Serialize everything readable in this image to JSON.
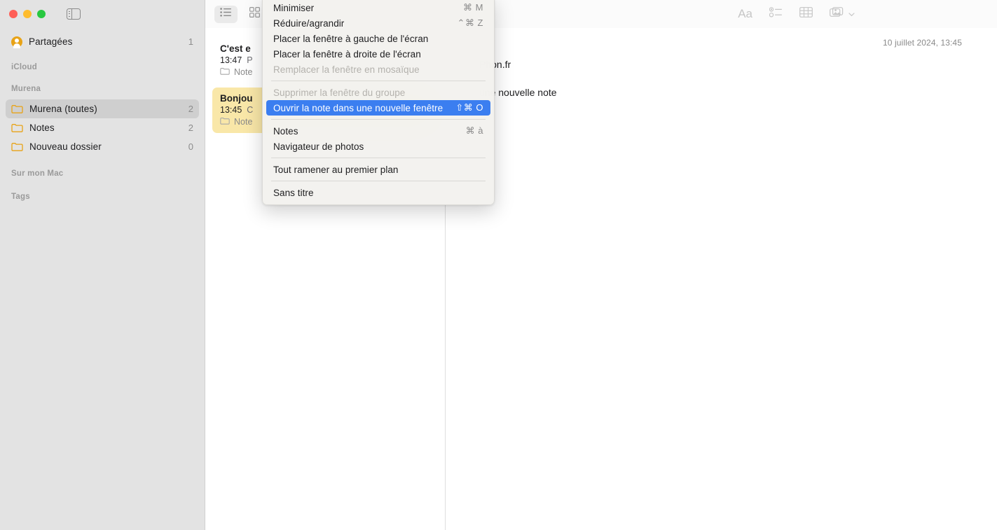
{
  "window": {
    "traffic_lights": [
      "close",
      "minimize",
      "maximize"
    ],
    "sidebar_toggle_icon": "sidebar-toggle-icon"
  },
  "sidebar": {
    "shared": {
      "label": "Partagées",
      "count": "1",
      "icon": "shared-person-icon"
    },
    "sections": [
      {
        "header": "iCloud",
        "items": []
      },
      {
        "header": "Murena",
        "items": [
          {
            "label": "Murena (toutes)",
            "count": "2",
            "icon": "folder-icon",
            "selected": true
          },
          {
            "label": "Notes",
            "count": "2",
            "icon": "folder-icon",
            "selected": false
          },
          {
            "label": "Nouveau dossier",
            "count": "0",
            "icon": "folder-icon",
            "selected": false
          }
        ]
      },
      {
        "header": "Sur mon Mac",
        "items": []
      },
      {
        "header": "Tags",
        "items": []
      }
    ]
  },
  "list_toolbar": {
    "buttons": [
      {
        "name": "list-view-button",
        "icon": "list-view-icon",
        "active": true
      },
      {
        "name": "gallery-view-button",
        "icon": "gallery-view-icon",
        "active": false
      }
    ]
  },
  "detail_toolbar": {
    "buttons": [
      {
        "name": "format-button",
        "icon": "format-aa-icon",
        "label": "Aa"
      },
      {
        "name": "checklist-button",
        "icon": "checklist-icon",
        "label": ""
      },
      {
        "name": "table-button",
        "icon": "table-icon",
        "label": ""
      },
      {
        "name": "media-button",
        "icon": "media-photo-icon",
        "label": ""
      }
    ]
  },
  "notes": [
    {
      "title": "C'est e",
      "time": "13:47",
      "preview": "P",
      "folder": "Note",
      "selected": false
    },
    {
      "title": "Bonjou",
      "time": "13:45",
      "preview": "C",
      "folder": "Note",
      "selected": true
    }
  ],
  "detail": {
    "date": "10 juillet 2024, 13:45",
    "lines": [
      "Phon.fr",
      "une nouvelle note"
    ]
  },
  "menu": {
    "items": [
      {
        "label": "Minimiser",
        "shortcut": "⌘ M",
        "state": "normal",
        "type": "item"
      },
      {
        "label": "Réduire/agrandir",
        "shortcut": "⌃⌘ Z",
        "state": "normal",
        "type": "item"
      },
      {
        "label": "Placer la fenêtre à gauche de l'écran",
        "shortcut": "",
        "state": "normal",
        "type": "item"
      },
      {
        "label": "Placer la fenêtre à droite de l'écran",
        "shortcut": "",
        "state": "normal",
        "type": "item"
      },
      {
        "label": "Remplacer la fenêtre en mosaïque",
        "shortcut": "",
        "state": "disabled",
        "type": "item"
      },
      {
        "label": "",
        "shortcut": "",
        "state": "normal",
        "type": "separator"
      },
      {
        "label": "Supprimer la fenêtre du groupe",
        "shortcut": "",
        "state": "disabled",
        "type": "item"
      },
      {
        "label": "Ouvrir la note dans une nouvelle fenêtre",
        "shortcut": "⇧⌘ O",
        "state": "highlight",
        "type": "item"
      },
      {
        "label": "",
        "shortcut": "",
        "state": "normal",
        "type": "separator"
      },
      {
        "label": "Notes",
        "shortcut": "⌘ à",
        "state": "normal",
        "type": "item"
      },
      {
        "label": "Navigateur de photos",
        "shortcut": "",
        "state": "normal",
        "type": "item"
      },
      {
        "label": "",
        "shortcut": "",
        "state": "normal",
        "type": "separator"
      },
      {
        "label": "Tout ramener au premier plan",
        "shortcut": "",
        "state": "normal",
        "type": "item"
      },
      {
        "label": "",
        "shortcut": "",
        "state": "normal",
        "type": "separator"
      },
      {
        "label": "Sans titre",
        "shortcut": "",
        "state": "normal",
        "type": "item"
      }
    ]
  },
  "colors": {
    "sidebar_bg": "#e3e3e3",
    "selected_note_bg": "#f9e7a8",
    "menu_highlight": "#3b7ef0",
    "folder_icon": "#e8a317",
    "traffic_red": "#ff5f57",
    "traffic_yellow": "#febc2e",
    "traffic_green": "#28c840"
  }
}
